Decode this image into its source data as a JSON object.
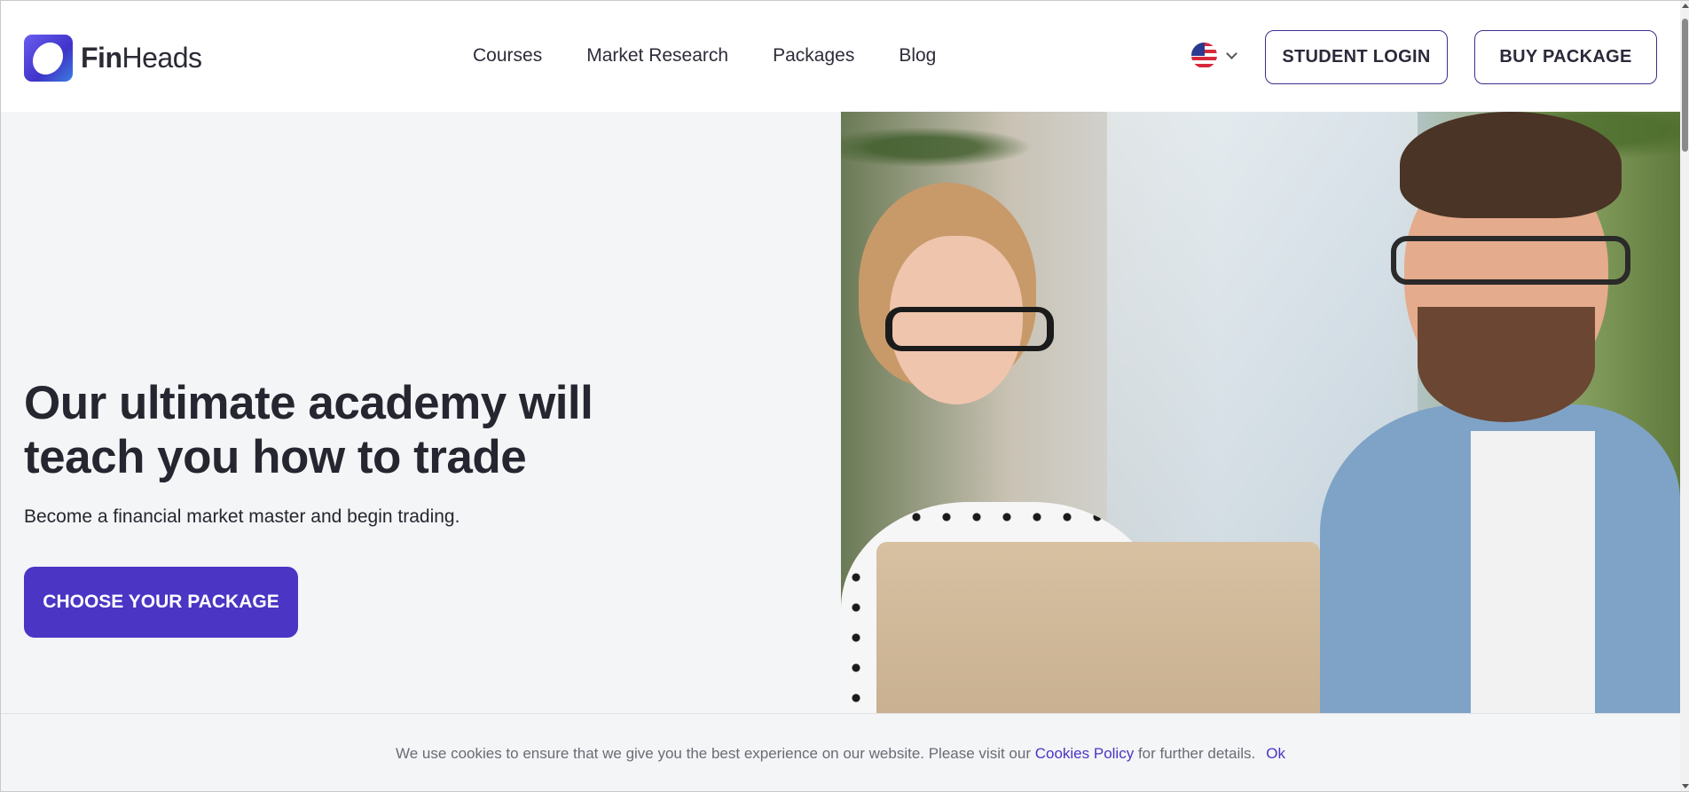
{
  "brand": {
    "name_bold": "Fin",
    "name_regular": "Heads"
  },
  "nav": {
    "items": [
      {
        "label": "Courses"
      },
      {
        "label": "Market Research"
      },
      {
        "label": "Packages"
      },
      {
        "label": "Blog"
      }
    ]
  },
  "language": {
    "icon": "us-flag-icon"
  },
  "header_buttons": {
    "student_login": "STUDENT LOGIN",
    "buy_package": "BUY PACKAGE"
  },
  "hero": {
    "title": "Our ultimate academy will teach you how to trade",
    "subtitle": "Become a financial market master and begin trading.",
    "cta_label": "CHOOSE YOUR PACKAGE"
  },
  "cookie": {
    "text_before": "We use cookies to ensure that we give you the best experience on our website. Please visit our ",
    "link_label": "Cookies Policy",
    "text_after": " for further details.",
    "ok_label": "Ok"
  },
  "colors": {
    "accent": "#4a35c4",
    "hero_background": "#f4f5f7",
    "text_dark": "#25262f"
  }
}
